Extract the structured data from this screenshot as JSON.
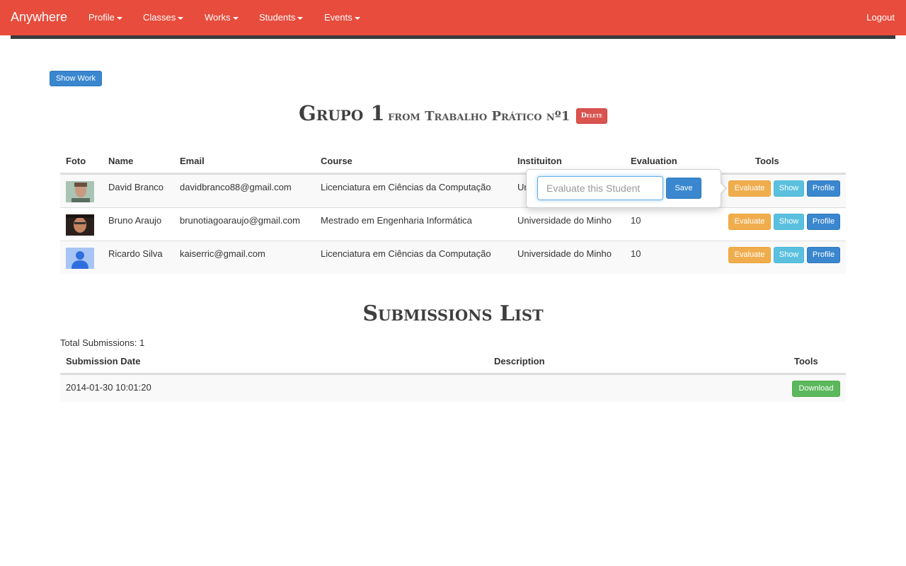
{
  "navbar": {
    "brand": "Anywhere",
    "menu": [
      {
        "label": "Profile"
      },
      {
        "label": "Classes"
      },
      {
        "label": "Works"
      },
      {
        "label": "Students"
      },
      {
        "label": "Events"
      }
    ],
    "logout": "Logout",
    "color": "#e74c3c"
  },
  "show_work_button": "Show Work",
  "group": {
    "name": "Grupo 1",
    "from_text": "from Trabalho Prático nº1",
    "delete_label": "Delete"
  },
  "students_table": {
    "headers": [
      "Foto",
      "Name",
      "Email",
      "Course",
      "Instituiton",
      "Evaluation",
      "Tools"
    ],
    "rows": [
      {
        "name": "David Branco",
        "email": "davidbranco88@gmail.com",
        "course": "Licenciatura em Ciências da Computação",
        "institution": "Un",
        "evaluation": ""
      },
      {
        "name": "Bruno Araujo",
        "email": "brunotiagoaraujo@gmail.com",
        "course": "Mestrado em Engenharia Informática",
        "institution": "Universidade do Minho",
        "evaluation": "10"
      },
      {
        "name": "Ricardo Silva",
        "email": "kaiserric@gmail.com",
        "course": "Licenciatura em Ciências da Computação",
        "institution": "Universidade do Minho",
        "evaluation": "10"
      }
    ],
    "tools": {
      "evaluate": "Evaluate",
      "show": "Show",
      "profile": "Profile"
    }
  },
  "popover": {
    "input_placeholder": "Evaluate this Student",
    "save_label": "Save"
  },
  "submissions": {
    "title": "Submissions List",
    "total_text": "Total Submissions: 1",
    "headers": [
      "Submission Date",
      "Description",
      "Tools"
    ],
    "rows": [
      {
        "date": "2014-01-30 10:01:20",
        "description": "",
        "download": "Download"
      }
    ]
  }
}
